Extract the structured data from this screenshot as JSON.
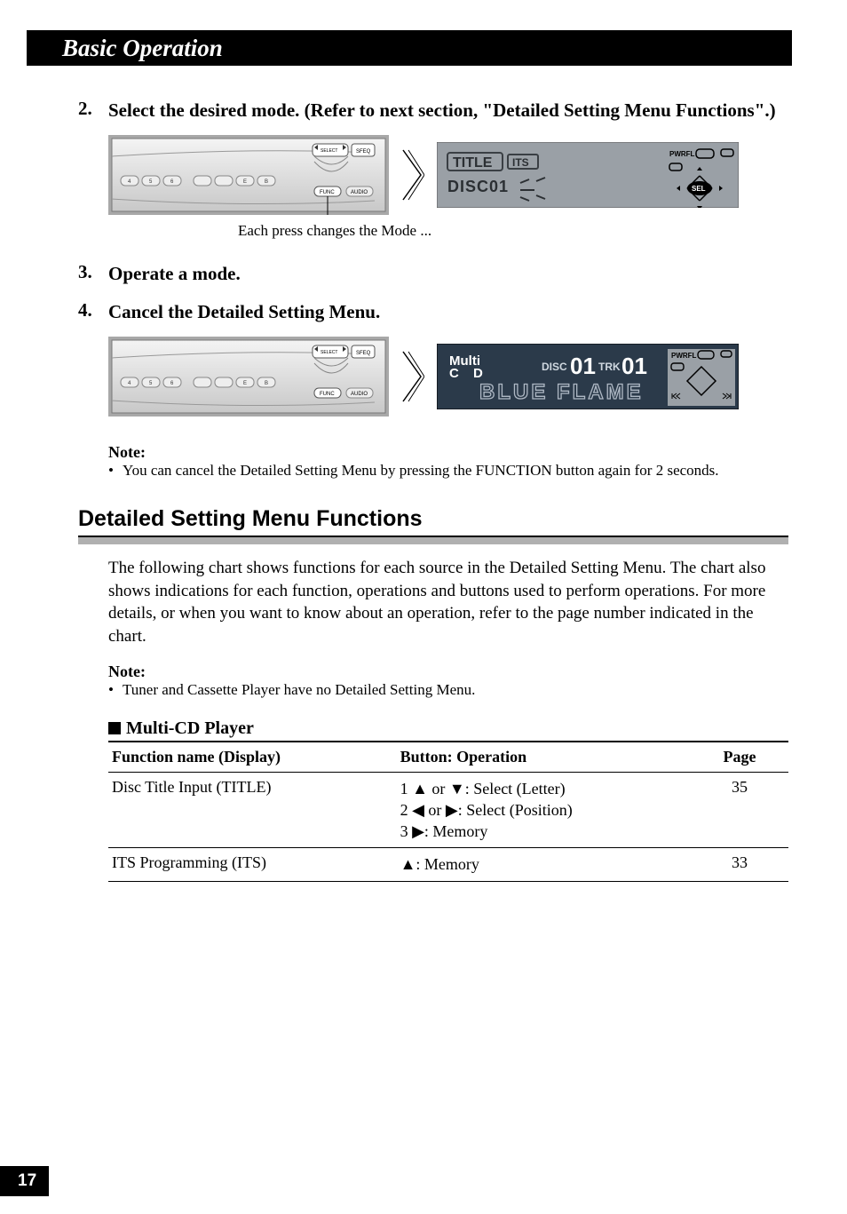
{
  "header": {
    "title": "Basic Operation"
  },
  "steps": {
    "s2": {
      "num": "2.",
      "text": "Select the desired mode. (Refer to next section, \"Detailed Setting Menu Functions\".)"
    },
    "s2_caption": "Each press changes the Mode ...",
    "s3": {
      "num": "3.",
      "text": "Operate a mode."
    },
    "s4": {
      "num": "4.",
      "text": "Cancel the Detailed Setting Menu."
    }
  },
  "lcd1": {
    "title": "TITLE",
    "its": "ITS",
    "disc": "DISC01",
    "pwr": "PWRFL",
    "sel": "SEL"
  },
  "lcd2": {
    "multi": "Multi",
    "cd": "C D",
    "disc": "DISC01",
    "trk": "TRK01",
    "name": "BLUE FLAME",
    "pwr": "PWRFL"
  },
  "note1": {
    "title": "Note:",
    "bullet": "You can cancel the Detailed Setting Menu by pressing the FUNCTION button again for 2 seconds."
  },
  "section": {
    "title": "Detailed Setting Menu Functions",
    "para": "The following chart shows functions for each source in the Detailed Setting Menu. The chart also shows indications for each function, operations and buttons used to perform operations. For more details, or when you want to know about an operation, refer to the page number indicated in the chart.",
    "note_title": "Note:",
    "note_bullet": "Tuner and Cassette Player have no Detailed Setting Menu.",
    "sub": "Multi-CD Player"
  },
  "table": {
    "headers": {
      "func": "Function name (Display)",
      "btn": "Button: Operation",
      "page": "Page"
    },
    "rows": [
      {
        "func": "Disc Title Input (TITLE)",
        "ops": [
          "1 ▲ or ▼: Select (Letter)",
          "2 ◀ or ▶: Select (Position)",
          "3 ▶: Memory"
        ],
        "page": "35"
      },
      {
        "func": "ITS Programming (ITS)",
        "ops": [
          "▲: Memory"
        ],
        "page": "33"
      }
    ]
  },
  "device_labels": {
    "select": "SELECT",
    "sfeq": "SFEQ",
    "func": "FUNC",
    "audio": "AUDIO",
    "b4": "4",
    "b5": "5",
    "b6": "6",
    "E": "E",
    "B": "B"
  },
  "page_number": "17"
}
